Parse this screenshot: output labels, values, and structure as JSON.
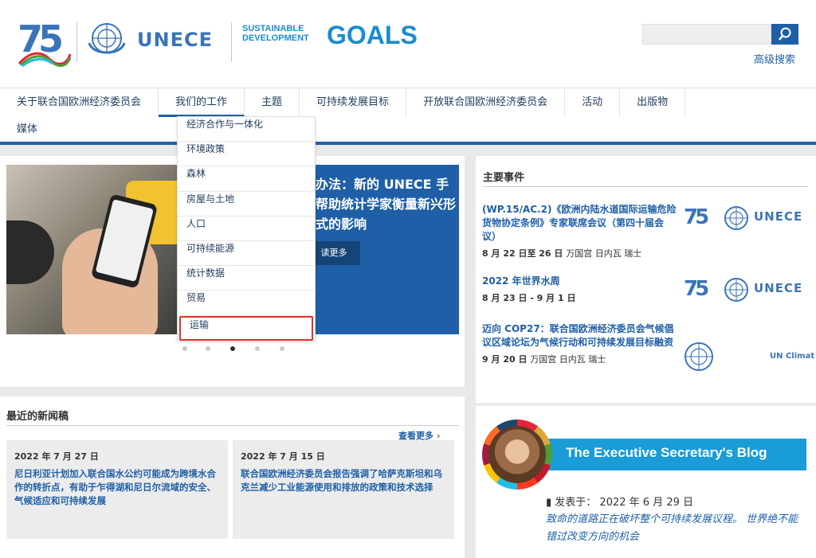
{
  "header": {
    "logo_number": "75",
    "org": "UNECE",
    "sdg_line1": "SUSTAINABLE",
    "sdg_line2": "DEVELOPMENT",
    "sdg_goals": "GOALS",
    "advanced_search": "高级搜索",
    "search_placeholder": ""
  },
  "nav": {
    "items": [
      "关于联合国欧洲经济委员会",
      "我们的工作",
      "主题",
      "可持续发展目标",
      "开放联合国欧洲经济委员会",
      "活动",
      "出版物"
    ],
    "row2": [
      "媒体"
    ]
  },
  "dropdown": {
    "items": [
      "经济合作与一体化",
      "环境政策",
      "森林",
      "房屋与土地",
      "人口",
      "可持续能源",
      "统计数据",
      "贸易",
      "运输"
    ],
    "selected": "运输"
  },
  "hero": {
    "title": "办法：新的 UNECE 手帮助统计学家衡量新兴形式的影响",
    "more": "读更多"
  },
  "events": {
    "heading": "主要事件",
    "items": [
      {
        "title": "(WP.15/AC.2)《欧洲内陆水道国际运输危险货物协定条例》专家联席会议（第四十届会议）",
        "date": "8 月 22 日至 26 日",
        "place": "万国宫 日内瓦 瑞士",
        "logo_text": "UNECE"
      },
      {
        "title": "2022 年世界水周",
        "date": "8 月 23 日 - 9 月 1 日",
        "place": "",
        "logo_text": "UNECE"
      },
      {
        "title": "迈向 COP27：联合国欧洲经济委员会气候倡议区域论坛为气候行动和可持续发展目标融资",
        "date": "9 月 20 日",
        "place": "万国宫 日内瓦 瑞士",
        "logo_text": "UN Climat"
      }
    ]
  },
  "news": {
    "heading": "最近的新闻稿",
    "see_more": "查看更多",
    "items": [
      {
        "date": "2022 年 7 月 27 日",
        "text": "尼日利亚计划加入联合国水公约可能成为跨境水合作的转折点，有助于乍得湖和尼日尔流域的安全、气候适应和可持续发展"
      },
      {
        "date": "2022 年 7 月 15 日",
        "text": "联合国欧洲经济委员会报告强调了哈萨克斯坦和乌克兰减少工业能源使用和排放的政策和技术选择"
      }
    ]
  },
  "blog": {
    "banner": "The Executive Secretary's Blog",
    "posted": "发表于：  2022 年 6 月 29 日",
    "text": "致命的道路正在破坏整个可持续发展议程。 世界绝不能错过改变方向的机会"
  },
  "colors": {
    "primary": "#1f5fa7",
    "sdg_blue": "#1a8ccf",
    "highlight_red": "#e0322d"
  }
}
